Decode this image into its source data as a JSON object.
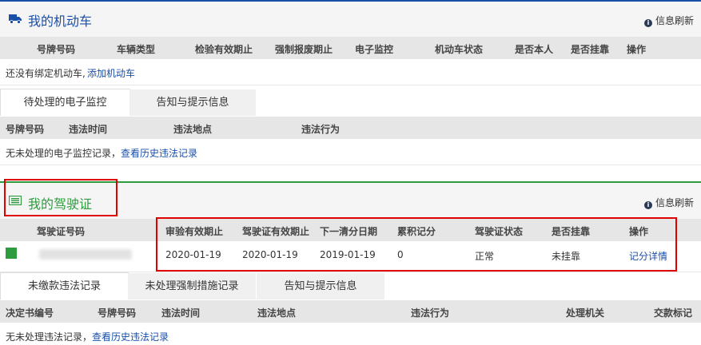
{
  "vehicles": {
    "title": "我的机动车",
    "refresh": "信息刷新",
    "columns": [
      "号牌号码",
      "车辆类型",
      "检验有效期止",
      "强制报废期止",
      "电子监控",
      "机动车状态",
      "是否本人",
      "是否挂靠",
      "操作"
    ],
    "empty_text": "还没有绑定机动车,",
    "add_link": "添加机动车"
  },
  "monitor": {
    "tabs": [
      "待处理的电子监控",
      "告知与提示信息"
    ],
    "columns": [
      "号牌号码",
      "违法时间",
      "违法地点",
      "违法行为"
    ],
    "empty_text": "无未处理的电子监控记录，",
    "history_link": "查看历史违法记录"
  },
  "license": {
    "title": "我的驾驶证",
    "refresh": "信息刷新",
    "columns": [
      "驾驶证号码",
      "审验有效期止",
      "驾驶证有效期止",
      "下一清分日期",
      "累积记分",
      "驾驶证状态",
      "是否挂靠",
      "操作"
    ],
    "row": {
      "review_expiry": "2020-01-19",
      "license_expiry": "2020-01-19",
      "next_clear_date": "2019-01-19",
      "points": "0",
      "status": "正常",
      "affiliated": "未挂靠",
      "action": "记分详情"
    }
  },
  "violations": {
    "tabs": [
      "未缴款违法记录",
      "未处理强制措施记录",
      "告知与提示信息"
    ],
    "columns": [
      "决定书编号",
      "号牌号码",
      "违法时间",
      "违法地点",
      "违法行为",
      "处理机关",
      "交款标记"
    ],
    "empty_text": "无未处理违法记录，",
    "history_link": "查看历史违法记录"
  },
  "colors": {
    "vehicle_accent": "#1a4fa8",
    "license_accent": "#2e9b3e",
    "highlight": "#e00000"
  }
}
